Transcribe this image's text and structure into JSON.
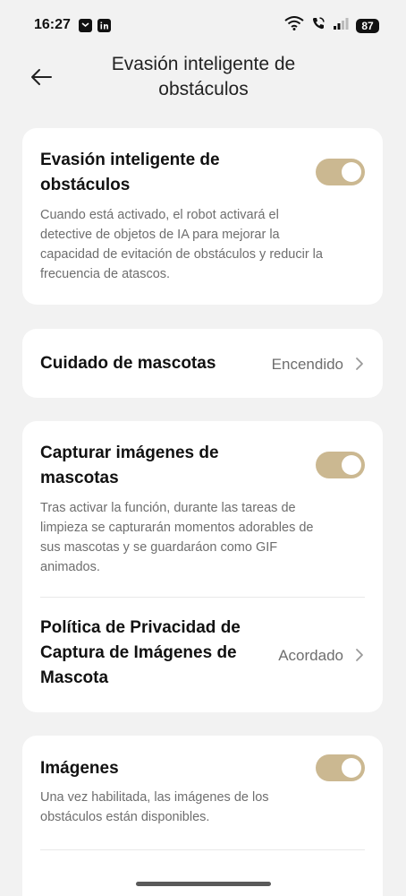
{
  "status_bar": {
    "time": "16:27",
    "battery": "87",
    "notification_icons": [
      "mail-icon",
      "linkedin-icon"
    ],
    "system_icons": [
      "wifi-icon",
      "call-icon",
      "signal-icon",
      "battery-icon"
    ]
  },
  "header": {
    "title": "Evasión inteligente de obstáculos",
    "back_icon": "arrow-left-icon"
  },
  "sections": {
    "obstacle_avoidance": {
      "title": "Evasión inteligente de obstáculos",
      "description": "Cuando está activado, el robot activará el detective de objetos de IA para mejorar la capacidad de evitación de obstáculos y reducir la frecuencia de atascos.",
      "enabled": true
    },
    "pet_care": {
      "title": "Cuidado de mascotas",
      "value": "Encendido"
    },
    "pet_capture": {
      "title": "Capturar imágenes de mascotas",
      "description": "Tras activar la función, durante las tareas de limpieza se capturarán momentos adorables de sus mascotas y se guardaráon como GIF animados.",
      "enabled": true
    },
    "pet_privacy": {
      "title": "Política de Privacidad de Captura de Imágenes de Mascota",
      "value": "Acordado"
    },
    "images": {
      "title": "Imágenes",
      "description": "Una vez habilitada, las imágenes de los obstáculos están disponibles.",
      "enabled": true
    }
  },
  "colors": {
    "background": "#f2f2f2",
    "card": "#ffffff",
    "toggle_on": "#cbb891",
    "secondary_text": "#6e6e6e"
  }
}
